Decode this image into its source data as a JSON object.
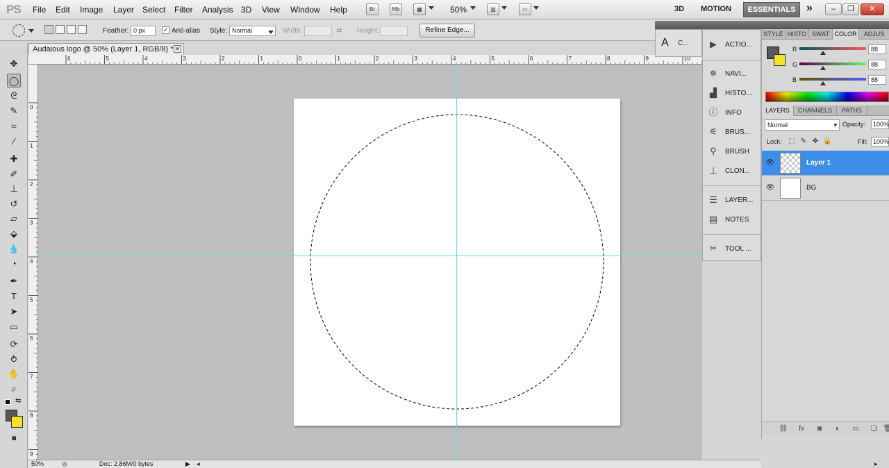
{
  "app": {
    "logo": "PS"
  },
  "menu": {
    "items": [
      "File",
      "Edit",
      "Image",
      "Layer",
      "Select",
      "Filter",
      "Analysis",
      "3D",
      "View",
      "Window",
      "Help"
    ],
    "bridge": "Br",
    "minibridge": "Mb",
    "zoom": "50%",
    "workspaces": [
      "3D",
      "MOTION",
      "ESSENTIALS"
    ],
    "more": "»"
  },
  "options": {
    "feather_label": "Feather:",
    "feather_value": "0 px",
    "antialias_label": "Anti-alias",
    "antialias_checked": "✓",
    "style_label": "Style:",
    "style_value": "Normal",
    "width_label": "Width:",
    "height_label": "Height:",
    "refine_edge": "Refine Edge..."
  },
  "document": {
    "tab_title": "Audaious logo @ 50% (Layer 1, RGB/8) *",
    "ruler_top": [
      "6",
      "5",
      "4",
      "3",
      "2",
      "1",
      "0",
      "1",
      "2",
      "3",
      "4",
      "5",
      "6",
      "7",
      "8",
      "9",
      "10"
    ],
    "ruler_left": [
      "0",
      "1",
      "2",
      "3",
      "4",
      "5",
      "6",
      "7",
      "8",
      "9"
    ]
  },
  "status": {
    "zoom": "50%",
    "doc": "Doc: 2.86M/0 bytes"
  },
  "collapsed_panels": {
    "character": "C...",
    "items": [
      {
        "label": "ACTIO...",
        "icon": "actions-icon"
      },
      {
        "label": "NAVI...",
        "icon": "navigator-icon"
      },
      {
        "label": "HISTO...",
        "icon": "histogram-icon"
      },
      {
        "label": "INFO",
        "icon": "info-icon"
      },
      {
        "label": "BRUS...",
        "icon": "brush-presets-icon"
      },
      {
        "label": "BRUSH",
        "icon": "brush-icon"
      },
      {
        "label": "CLON...",
        "icon": "clone-source-icon"
      },
      {
        "label": "LAYER...",
        "icon": "layer-comps-icon"
      },
      {
        "label": "NOTES",
        "icon": "notes-icon"
      },
      {
        "label": "TOOL ...",
        "icon": "tool-presets-icon"
      }
    ]
  },
  "color_panel": {
    "tabs": [
      "STYLE",
      "HISTO",
      "SWAT",
      "COLOR",
      "ADJUS"
    ],
    "channels": [
      {
        "label": "R",
        "value": "88",
        "track": "linear-gradient(to right,#005858,#ff5858)"
      },
      {
        "label": "G",
        "value": "88",
        "track": "linear-gradient(to right,#580058,#58ff58)"
      },
      {
        "label": "B",
        "value": "88",
        "track": "linear-gradient(to right,#585800,#5858ff)"
      }
    ],
    "fg_color": "#585858",
    "bg_color": "#f4e227"
  },
  "layers_panel": {
    "tabs": [
      "LAYERS",
      "CHANNELS",
      "PATHS"
    ],
    "blend_mode": "Normal",
    "opacity_label": "Opacity:",
    "opacity_value": "100%",
    "lock_label": "Lock:",
    "fill_label": "Fill:",
    "fill_value": "100%",
    "layers": [
      {
        "name": "Layer 1",
        "selected": true
      },
      {
        "name": "BG",
        "selected": false
      }
    ]
  },
  "colors": {
    "guide": "#57e1ec",
    "selection_highlight": "#3d8ee8"
  }
}
